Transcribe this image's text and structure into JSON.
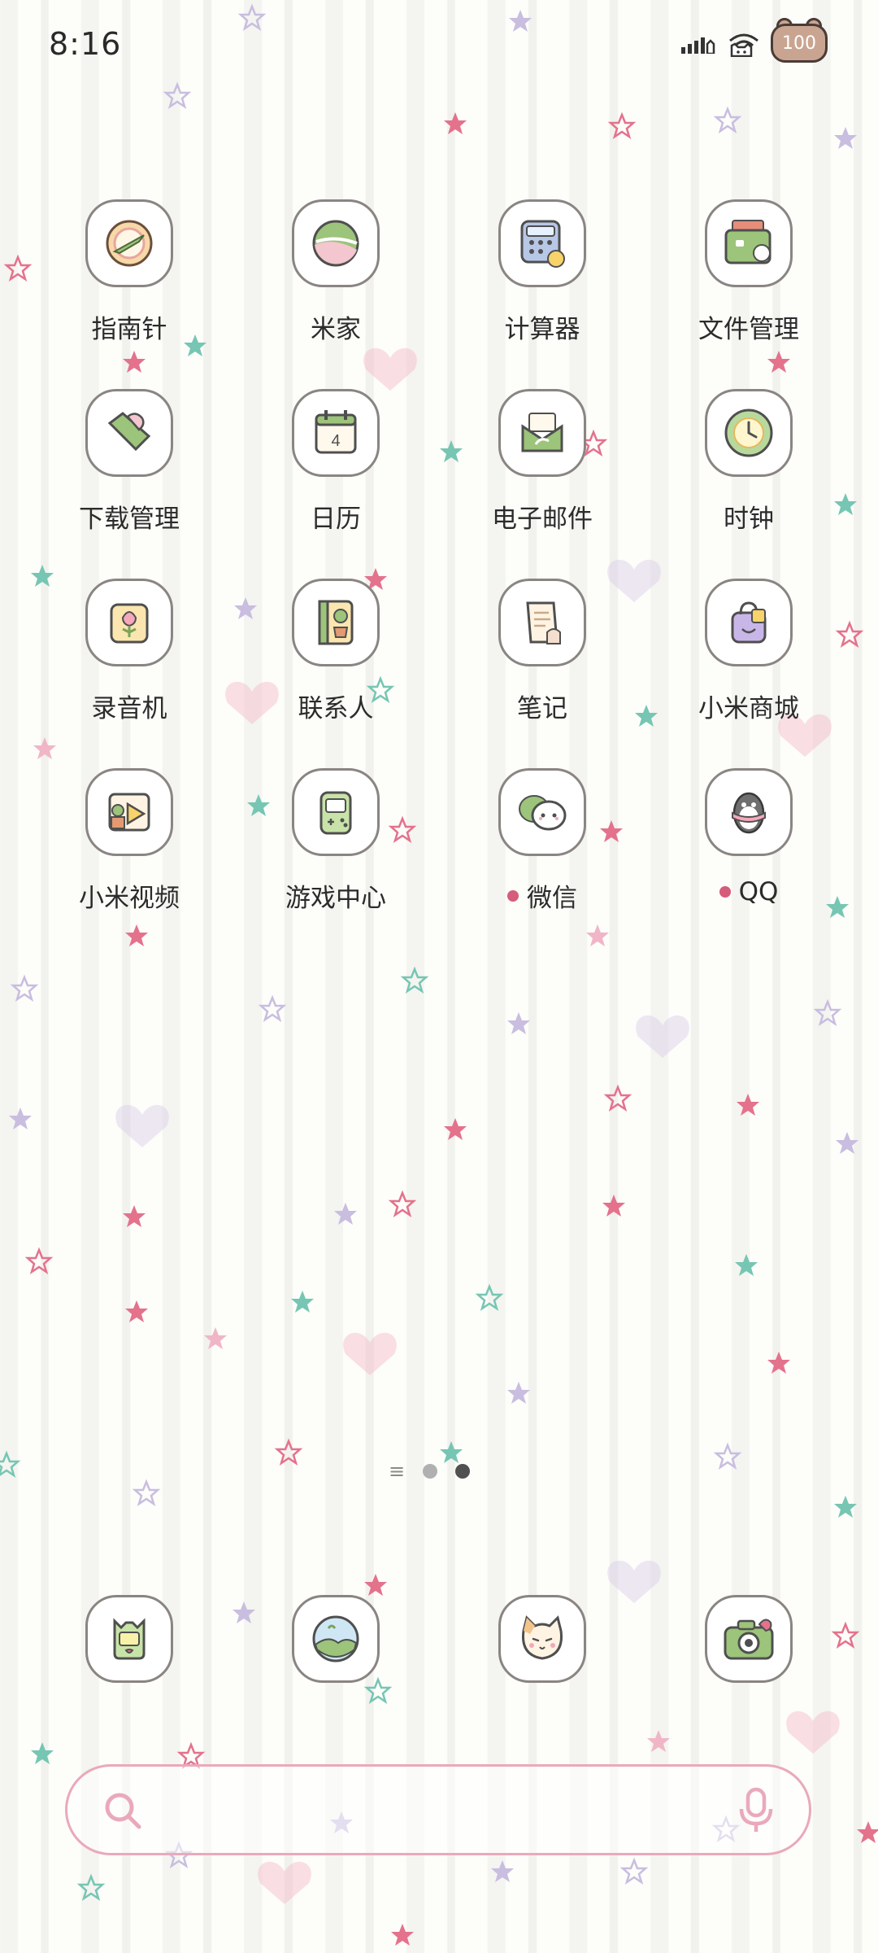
{
  "status_bar": {
    "time": "8:16",
    "battery": "100",
    "icons": [
      "signal-icon",
      "cat-icon",
      "wifi-icon",
      "battery-icon"
    ]
  },
  "apps": [
    {
      "label": "指南针",
      "icon": "compass-icon",
      "badge": false
    },
    {
      "label": "米家",
      "icon": "mijia-icon",
      "badge": false
    },
    {
      "label": "计算器",
      "icon": "calculator-icon",
      "badge": false
    },
    {
      "label": "文件管理",
      "icon": "file-manager-icon",
      "badge": false
    },
    {
      "label": "下载管理",
      "icon": "download-icon",
      "badge": false
    },
    {
      "label": "日历",
      "icon": "calendar-icon",
      "badge": false,
      "day": "4"
    },
    {
      "label": "电子邮件",
      "icon": "email-icon",
      "badge": false
    },
    {
      "label": "时钟",
      "icon": "clock-icon",
      "badge": false
    },
    {
      "label": "录音机",
      "icon": "recorder-icon",
      "badge": false
    },
    {
      "label": "联系人",
      "icon": "contacts-icon",
      "badge": false
    },
    {
      "label": "笔记",
      "icon": "notes-icon",
      "badge": false
    },
    {
      "label": "小米商城",
      "icon": "mi-store-icon",
      "badge": false
    },
    {
      "label": "小米视频",
      "icon": "mi-video-icon",
      "badge": false
    },
    {
      "label": "游戏中心",
      "icon": "game-center-icon",
      "badge": false
    },
    {
      "label": "微信",
      "icon": "wechat-icon",
      "badge": true
    },
    {
      "label": "QQ",
      "icon": "qq-icon",
      "badge": true
    }
  ],
  "page_indicator": {
    "pages": 2,
    "current": 2
  },
  "dock": [
    {
      "icon": "phone-icon"
    },
    {
      "icon": "gallery-icon"
    },
    {
      "icon": "messages-icon"
    },
    {
      "icon": "camera-icon"
    }
  ],
  "search_bar": {
    "icons": [
      "search-icon",
      "mic-icon"
    ]
  },
  "colors": {
    "accent_pink": "#eaa9bb",
    "badge": "#d55c7a",
    "tile_border": "#8a8582",
    "icon_green": "#9cc47a"
  }
}
